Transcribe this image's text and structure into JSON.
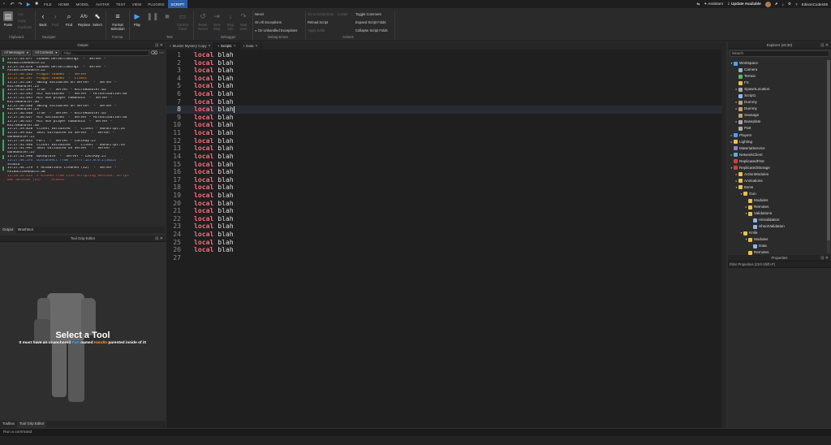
{
  "menubar": {
    "items": [
      "FILE",
      "HOME",
      "MODEL",
      "AVATAR",
      "TEST",
      "VIEW",
      "PLUGINS",
      "SCRIPT"
    ],
    "active_index": 7,
    "assistant": "Assistant",
    "update": "Update Available",
    "username": "EdisonCodes06"
  },
  "ribbon": {
    "paste": "Paste",
    "cut": "Cut",
    "copy": "Copy",
    "duplicate": "Duplicate",
    "back": "Back",
    "fwd": "Fwd",
    "find": "Find",
    "replace": "Replace",
    "select": "Select",
    "format_selection": "Format Selection",
    "play": "Play",
    "step_into": "Step Into",
    "step_over": "Step Over",
    "step_out": "Step Out",
    "current_client": "Current Client",
    "reset_server": "Reset Server",
    "view_step": "View Step",
    "debug_options": [
      "Never",
      "On All Exceptions",
      "On Unhandled Exceptions"
    ],
    "actions_col1": [
      "Go to Script Error",
      "Reload Script",
      "Apply Edits"
    ],
    "actions_col2": [
      "Toggle Comment",
      "Expand Script Folds",
      "Collapse Script Folds"
    ],
    "locate": "Locate",
    "groups": {
      "clipboard": "Clipboard",
      "navigate": "Navigate",
      "format": "Format",
      "test": "Test",
      "debugger": "Debugger",
      "debug_errors": "Debug Errors",
      "actions": "Actions"
    }
  },
  "output": {
    "title": "Output",
    "filter_messages": "All Messages",
    "filter_contexts": "All Contexts",
    "filter_placeholder": "Filter...",
    "lines": [
      {
        "text": "15:27:33.677  Loaded DefaultSwing2  -  Server -",
        "bar": true,
        "color": ""
      },
      {
        "text": "AnimationModule:22",
        "bar": false,
        "color": ""
      },
      {
        "text": "15:27:33.678  Loaded DefaultSwing1  -  Server -",
        "bar": true,
        "color": ""
      },
      {
        "text": "AnimationModule:22",
        "bar": false,
        "color": ""
      },
      {
        "text": "15:27:34.162  Plugin loaded  -  Server",
        "bar": true,
        "color": "orange"
      },
      {
        "text": "15:27:34.297  Plugin loaded  -  Client",
        "bar": true,
        "color": "orange"
      },
      {
        "text": "15:27:35.287  Swing validated on Server  -  Server -",
        "bar": true,
        "color": ""
      },
      {
        "text": "KnifeHandler:23",
        "bar": false,
        "color": ""
      },
      {
        "text": "15:27:35.291  true  -  Server - KnifeHandler:63",
        "bar": true,
        "color": ""
      },
      {
        "text": "15:27:35.495  Hit Validated  -  Server - HitValidation:46",
        "bar": true,
        "color": ""
      },
      {
        "text": "15:27:35.495  Hit non player humanoid  -  Server -",
        "bar": true,
        "color": ""
      },
      {
        "text": "KnifeHandler:46",
        "bar": false,
        "color": ""
      },
      {
        "text": "15:27:36.440  Swing validated on Server  -  Server -",
        "bar": true,
        "color": ""
      },
      {
        "text": "KnifeHandler:23",
        "bar": false,
        "color": ""
      },
      {
        "text": "15:27:36.440  true  -  Server - KnifeHandler:63",
        "bar": true,
        "color": ""
      },
      {
        "text": "15:27:36.657  Hit Validated  -  Server - HitValidation:46",
        "bar": true,
        "color": ""
      },
      {
        "text": "15:27:36.657  Hit non player humanoid  -  Server -",
        "bar": true,
        "color": ""
      },
      {
        "text": "KnifeHandler:48",
        "bar": false,
        "color": ""
      },
      {
        "text": "15:27:39.828  Client Validated  -  Client - GunScript:33",
        "bar": true,
        "color": ""
      },
      {
        "text": "15:27:39.832  Shot validated on Server  -  Server -",
        "bar": true,
        "color": ""
      },
      {
        "text": "GunHandler:25",
        "bar": false,
        "color": ""
      },
      {
        "text": "15:27:39.833  Part  -  Server - CastRay:25",
        "bar": true,
        "color": ""
      },
      {
        "text": "15:27:41.996  Client Validated  -  Client - GunScript:33",
        "bar": true,
        "color": ""
      },
      {
        "text": "15:27:41.997  Shot validated on Server  -  Server -",
        "bar": true,
        "color": ""
      },
      {
        "text": "GunHandler:25",
        "bar": false,
        "color": ""
      },
      {
        "text": "15:27:41.998  Baseplate  -  Server - CastRay:25",
        "bar": true,
        "color": ""
      },
      {
        "text": "15:27:44.574  Disconnect from ::ffff:127.0.0.1|50225  -",
        "bar": false,
        "color": "blue"
      },
      {
        "text": "Studio",
        "bar": false,
        "color": ""
      },
      {
        "text": "15:27:44.579  ▸ Animations Cleaned (x2)  -  Server -",
        "bar": true,
        "color": ""
      },
      {
        "text": "AnimationModule:30",
        "bar": false,
        "color": ""
      },
      {
        "text": "15:28:14.433  ▸ Kicked from Live Scripting Session: Script",
        "bar": false,
        "color": "red"
      },
      {
        "text": "was deleted (x3)  -  Studio",
        "bar": false,
        "color": "red"
      }
    ],
    "tabs": [
      "Output",
      "Brushtool"
    ]
  },
  "tool_grip": {
    "title": "Tool Grip Editor",
    "heading": "Select a Tool",
    "sub_prefix": "It must have an unanchored ",
    "sub_part": "Part",
    "sub_mid": " named ",
    "sub_handle": "Handle",
    "sub_suffix": " parented inside of it!"
  },
  "bottom_tabs": [
    "Toolbox",
    "Tool Grip Editor"
  ],
  "editor": {
    "tabs": [
      "Murder Mystery Copy",
      "Script1",
      "Data"
    ],
    "active_tab": 1,
    "keyword": "local",
    "identifier": "blah",
    "line_count": 27,
    "code_lines": 26,
    "cursor_line": 8
  },
  "explorer": {
    "title": "Explorer (v0.30)",
    "search_placeholder": "Search",
    "items": [
      {
        "label": "Workspace",
        "depth": 0,
        "arrow": "▾",
        "color": "#4aa3ff"
      },
      {
        "label": "Camera",
        "depth": 1,
        "arrow": "",
        "color": "#9ab0c8"
      },
      {
        "label": "Terrain",
        "depth": 1,
        "arrow": "",
        "color": "#5cb85c"
      },
      {
        "label": "FX",
        "depth": 1,
        "arrow": "",
        "color": "#e8c24a"
      },
      {
        "label": "SpawnLocation",
        "depth": 1,
        "arrow": "▸",
        "color": "#aaa"
      },
      {
        "label": "Script1",
        "depth": 1,
        "arrow": "",
        "color": "#8fb6e8"
      },
      {
        "label": "Dummy",
        "depth": 1,
        "arrow": "▸",
        "color": "#c0a070"
      },
      {
        "label": "Dummy",
        "depth": 1,
        "arrow": "▸",
        "color": "#c0a070"
      },
      {
        "label": "Sausage",
        "depth": 1,
        "arrow": "",
        "color": "#c0a070"
      },
      {
        "label": "Baseplate",
        "depth": 1,
        "arrow": "▸",
        "color": "#aaa"
      },
      {
        "label": "Part",
        "depth": 1,
        "arrow": "",
        "color": "#aaa"
      },
      {
        "label": "Players",
        "depth": 0,
        "arrow": "▸",
        "color": "#4aa3ff"
      },
      {
        "label": "Lighting",
        "depth": 0,
        "arrow": "▸",
        "color": "#f0c040"
      },
      {
        "label": "MaterialService",
        "depth": 0,
        "arrow": "",
        "color": "#9a7ad0"
      },
      {
        "label": "NetworkClient",
        "depth": 0,
        "arrow": "▸",
        "color": "#5ab0d0"
      },
      {
        "label": "ReplicatedFirst",
        "depth": 0,
        "arrow": "",
        "color": "#d04040"
      },
      {
        "label": "ReplicatedStorage",
        "depth": 0,
        "arrow": "▾",
        "color": "#d04040"
      },
      {
        "label": "ActionModules",
        "depth": 1,
        "arrow": "▸",
        "color": "#e8c24a"
      },
      {
        "label": "Animations",
        "depth": 1,
        "arrow": "▸",
        "color": "#e8c24a"
      },
      {
        "label": "Items",
        "depth": 1,
        "arrow": "▾",
        "color": "#e8c24a"
      },
      {
        "label": "Gun",
        "depth": 2,
        "arrow": "▾",
        "color": "#e8c24a"
      },
      {
        "label": "Modules",
        "depth": 3,
        "arrow": "",
        "color": "#e8c24a"
      },
      {
        "label": "Remotes",
        "depth": 3,
        "arrow": "▸",
        "color": "#e8c24a"
      },
      {
        "label": "Validations",
        "depth": 3,
        "arrow": "▾",
        "color": "#e8c24a"
      },
      {
        "label": "HitValidation",
        "depth": 4,
        "arrow": "",
        "color": "#8fb6e8"
      },
      {
        "label": "ShootValidation",
        "depth": 4,
        "arrow": "",
        "color": "#8fb6e8"
      },
      {
        "label": "Knife",
        "depth": 2,
        "arrow": "▾",
        "color": "#e8c24a"
      },
      {
        "label": "Modules",
        "depth": 3,
        "arrow": "▾",
        "color": "#e8c24a"
      },
      {
        "label": "Data",
        "depth": 4,
        "arrow": "",
        "color": "#8fb6e8"
      },
      {
        "label": "Remotes",
        "depth": 3,
        "arrow": "",
        "color": "#e8c24a"
      }
    ]
  },
  "properties": {
    "title": "Properties",
    "filter_placeholder": "Filter Properties (Ctrl+Shift+P)"
  },
  "command": {
    "placeholder": "Run a command"
  }
}
